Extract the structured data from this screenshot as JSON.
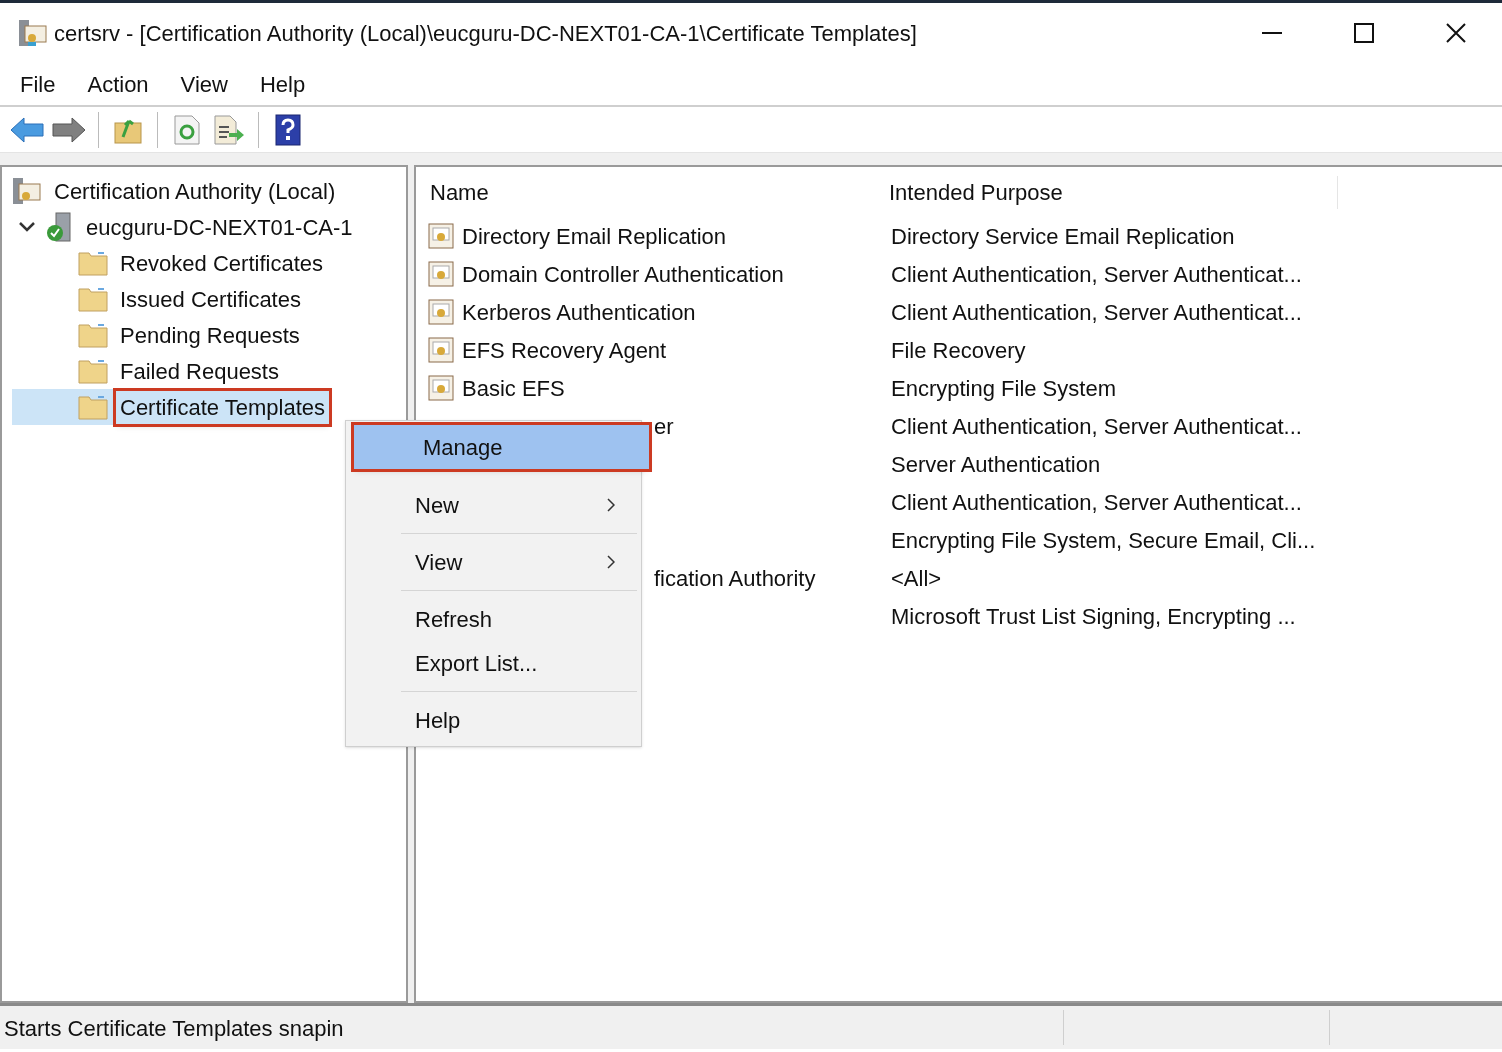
{
  "window": {
    "title": "certsrv - [Certification Authority (Local)\\eucguru-DC-NEXT01-CA-1\\Certificate Templates]"
  },
  "menu_bar": [
    "File",
    "Action",
    "View",
    "Help"
  ],
  "tree": [
    {
      "label": "Certification Authority (Local)",
      "kind": "root",
      "selected": false,
      "annotated": false,
      "children": [
        {
          "label": "eucguru-DC-NEXT01-CA-1",
          "kind": "server",
          "expanded": true,
          "selected": false,
          "annotated": false,
          "children": [
            {
              "label": "Revoked Certificates",
              "kind": "folder",
              "selected": false,
              "annotated": false
            },
            {
              "label": "Issued Certificates",
              "kind": "folder",
              "selected": false,
              "annotated": false
            },
            {
              "label": "Pending Requests",
              "kind": "folder",
              "selected": false,
              "annotated": false
            },
            {
              "label": "Failed Requests",
              "kind": "folder",
              "selected": false,
              "annotated": false
            },
            {
              "label": "Certificate Templates",
              "kind": "folder",
              "selected": true,
              "annotated": true
            }
          ]
        }
      ]
    }
  ],
  "table": {
    "columns": [
      "Name",
      "Intended Purpose"
    ],
    "rows": [
      {
        "name": "Directory Email Replication",
        "purpose": "Directory Service Email Replication",
        "covered": false
      },
      {
        "name": "Domain Controller Authentication",
        "purpose": "Client Authentication, Server Authenticat...",
        "covered": false
      },
      {
        "name": "Kerberos Authentication",
        "purpose": "Client Authentication, Server Authenticat...",
        "covered": false
      },
      {
        "name": "EFS Recovery Agent",
        "purpose": "File Recovery",
        "covered": false
      },
      {
        "name": "Basic EFS",
        "purpose": "Encrypting File System",
        "covered": false
      },
      {
        "name": "er",
        "purpose": "Client Authentication, Server Authenticat...",
        "covered": true
      },
      {
        "purpose": "Server Authentication"
      },
      {
        "purpose": "Client Authentication, Server Authenticat..."
      },
      {
        "purpose": "Encrypting File System, Secure Email, Cli..."
      },
      {
        "name": "fication Authority",
        "purpose": "<All>",
        "covered": true
      },
      {
        "purpose": "Microsoft Trust List Signing, Encrypting ..."
      }
    ]
  },
  "context_menu": [
    {
      "kind": "item",
      "label": "Manage",
      "selected": true,
      "annotated": true,
      "submenu": false
    },
    {
      "kind": "gap"
    },
    {
      "kind": "item",
      "label": "New",
      "selected": false,
      "annotated": false,
      "submenu": true
    },
    {
      "kind": "separator"
    },
    {
      "kind": "item",
      "label": "View",
      "selected": false,
      "annotated": false,
      "submenu": true
    },
    {
      "kind": "separator"
    },
    {
      "kind": "item",
      "label": "Refresh",
      "selected": false,
      "annotated": false,
      "submenu": false
    },
    {
      "kind": "item",
      "label": "Export List...",
      "selected": false,
      "annotated": false,
      "submenu": false
    },
    {
      "kind": "separator"
    },
    {
      "kind": "item",
      "label": "Help",
      "selected": false,
      "annotated": false,
      "submenu": false
    }
  ],
  "status_bar": {
    "text": "Starts Certificate Templates snapin"
  }
}
